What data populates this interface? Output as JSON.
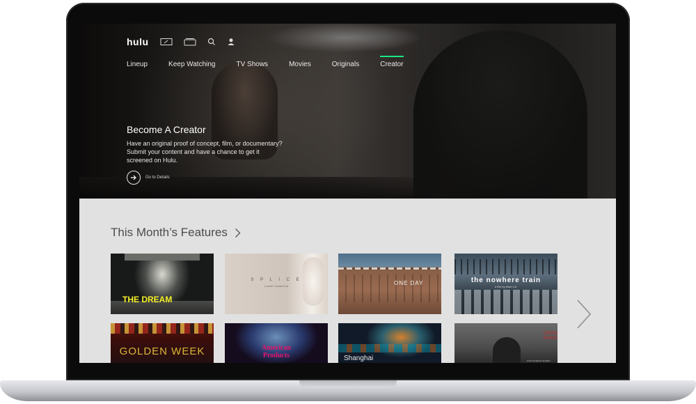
{
  "app": {
    "logo": "hulu"
  },
  "nav": {
    "tabs": [
      {
        "label": "Lineup",
        "active": false
      },
      {
        "label": "Keep Watching",
        "active": false
      },
      {
        "label": "TV Shows",
        "active": false
      },
      {
        "label": "Movies",
        "active": false
      },
      {
        "label": "Originals",
        "active": false
      },
      {
        "label": "Creator",
        "active": true
      }
    ],
    "icons": [
      "live-tv-icon",
      "library-icon",
      "search-icon",
      "profile-icon"
    ]
  },
  "hero": {
    "title": "Become A Creator",
    "description": "Have an original proof of concept, film, or documentary? Submit your content and have a chance to get it screened on Hulu.",
    "details_label": "Go to Details"
  },
  "features": {
    "title": "This Month’s Features",
    "cards": [
      {
        "title": "THE DREAM"
      },
      {
        "title": "S P L I C E",
        "subtitle": "A SAMMY TORRES FILM"
      },
      {
        "title": "ONE DAY"
      },
      {
        "title": "the nowhere train",
        "subtitle": "a film by shoe o.b."
      },
      {
        "title": "GOLDEN WEEK"
      },
      {
        "title": "American Products"
      },
      {
        "title": "Shanghai"
      },
      {
        "title": "CROSS ROADS",
        "subtitle": "A film by Marvin Hamilton"
      }
    ]
  },
  "colors": {
    "accent": "#1ce783",
    "hero_text": "#ffffff",
    "section_bg": "#e1e1e1",
    "section_title": "#4b4b4b"
  }
}
